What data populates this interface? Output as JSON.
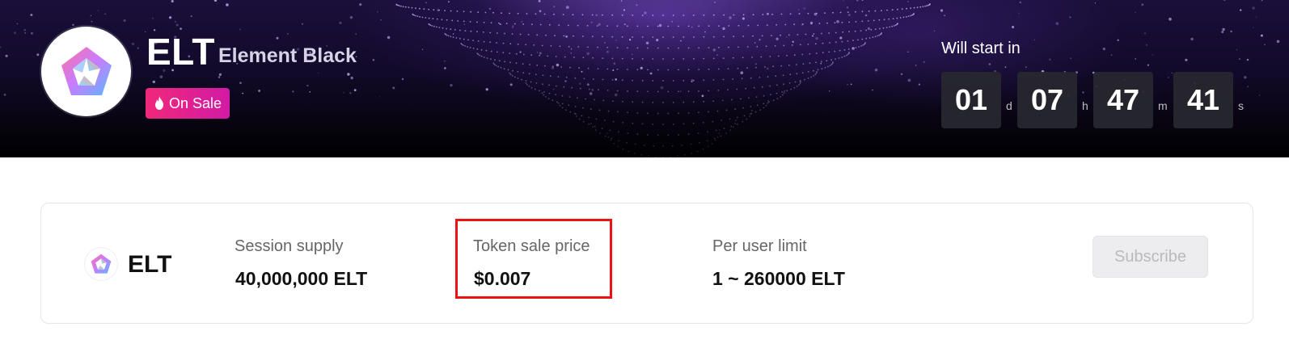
{
  "project": {
    "symbol": "ELT",
    "name": "Element Black",
    "status_badge": "On Sale"
  },
  "countdown": {
    "label": "Will start in",
    "days": "01",
    "days_unit": "d",
    "hours": "07",
    "hours_unit": "h",
    "minutes": "47",
    "minutes_unit": "m",
    "seconds": "41",
    "seconds_unit": "s"
  },
  "sale_card": {
    "symbol": "ELT",
    "stats": [
      {
        "label": "Session supply",
        "value": "40,000,000 ELT"
      },
      {
        "label": "Token sale price",
        "value": "$0.007"
      },
      {
        "label": "Per user limit",
        "value": "1 ~ 260000 ELT"
      }
    ],
    "subscribe_label": "Subscribe"
  },
  "colors": {
    "badge_gradient_start": "#f0287a",
    "badge_gradient_end": "#d21aa6",
    "highlight_border": "#ee1111",
    "subscribe_disabled_bg": "#ededef"
  },
  "icons": {
    "project_logo": "pentagon-logo-icon",
    "badge": "flame-icon"
  }
}
